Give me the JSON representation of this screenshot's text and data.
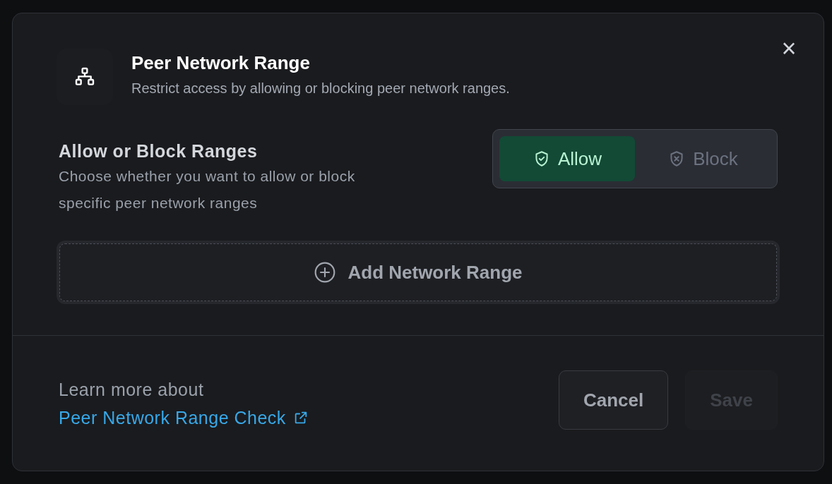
{
  "dialog": {
    "title": "Peer Network Range",
    "subtitle": "Restrict access by allowing or blocking peer network ranges.",
    "close": "×"
  },
  "mode": {
    "heading": "Allow or Block Ranges",
    "description": "Choose whether you want to allow or block specific peer network ranges",
    "options": [
      {
        "label": "Allow",
        "kind": "allow",
        "selected": true
      },
      {
        "label": "Block",
        "kind": "block",
        "selected": false
      }
    ]
  },
  "add_button": {
    "label": "Add Network Range"
  },
  "footer": {
    "note": "Learn more about",
    "link": "Peer Network Range Check",
    "buttons": [
      {
        "label": "Cancel",
        "disabled": false
      },
      {
        "label": "Save",
        "disabled": true
      }
    ]
  }
}
